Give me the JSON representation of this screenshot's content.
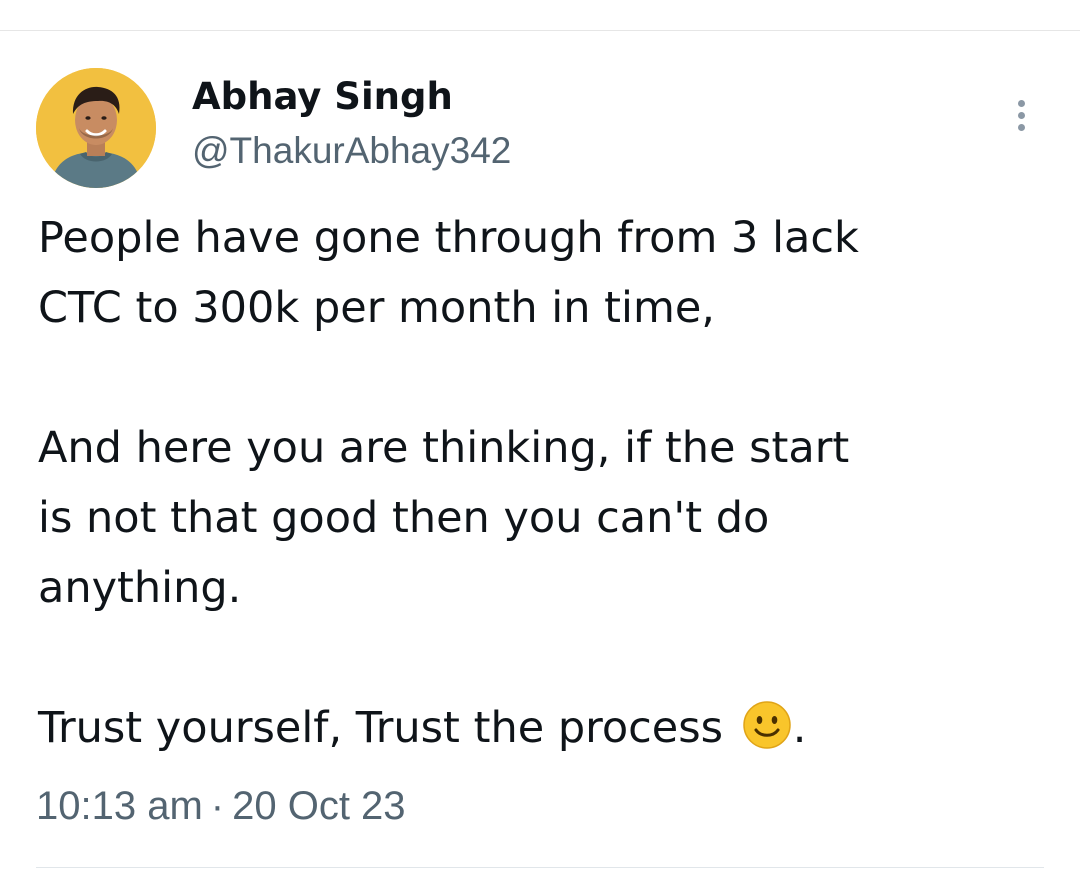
{
  "tweet": {
    "author": {
      "name": "Abhay Singh",
      "handle": "@ThakurAbhay342"
    },
    "body": {
      "paragraph_1": [
        "People have gone through from 3 lack",
        "CTC to 300k per month in time,"
      ],
      "paragraph_2": [
        "And here you are thinking, if the start",
        "is not that good then you can't do",
        "anything."
      ],
      "paragraph_3": {
        "text": "Trust yourself, Trust the process",
        "emoji": "slightly-smiling-face-icon",
        "suffix": "."
      }
    },
    "meta": {
      "time": "10:13 am",
      "separator": "·",
      "date": "20 Oct 23"
    },
    "menu_icon": "more-vertical-icon"
  },
  "colors": {
    "text_primary": "#0f1419",
    "text_secondary": "#536471",
    "avatar_background": "#f2c040",
    "emoji_face": "#f9c52b",
    "divider": "#e6e6e6"
  }
}
